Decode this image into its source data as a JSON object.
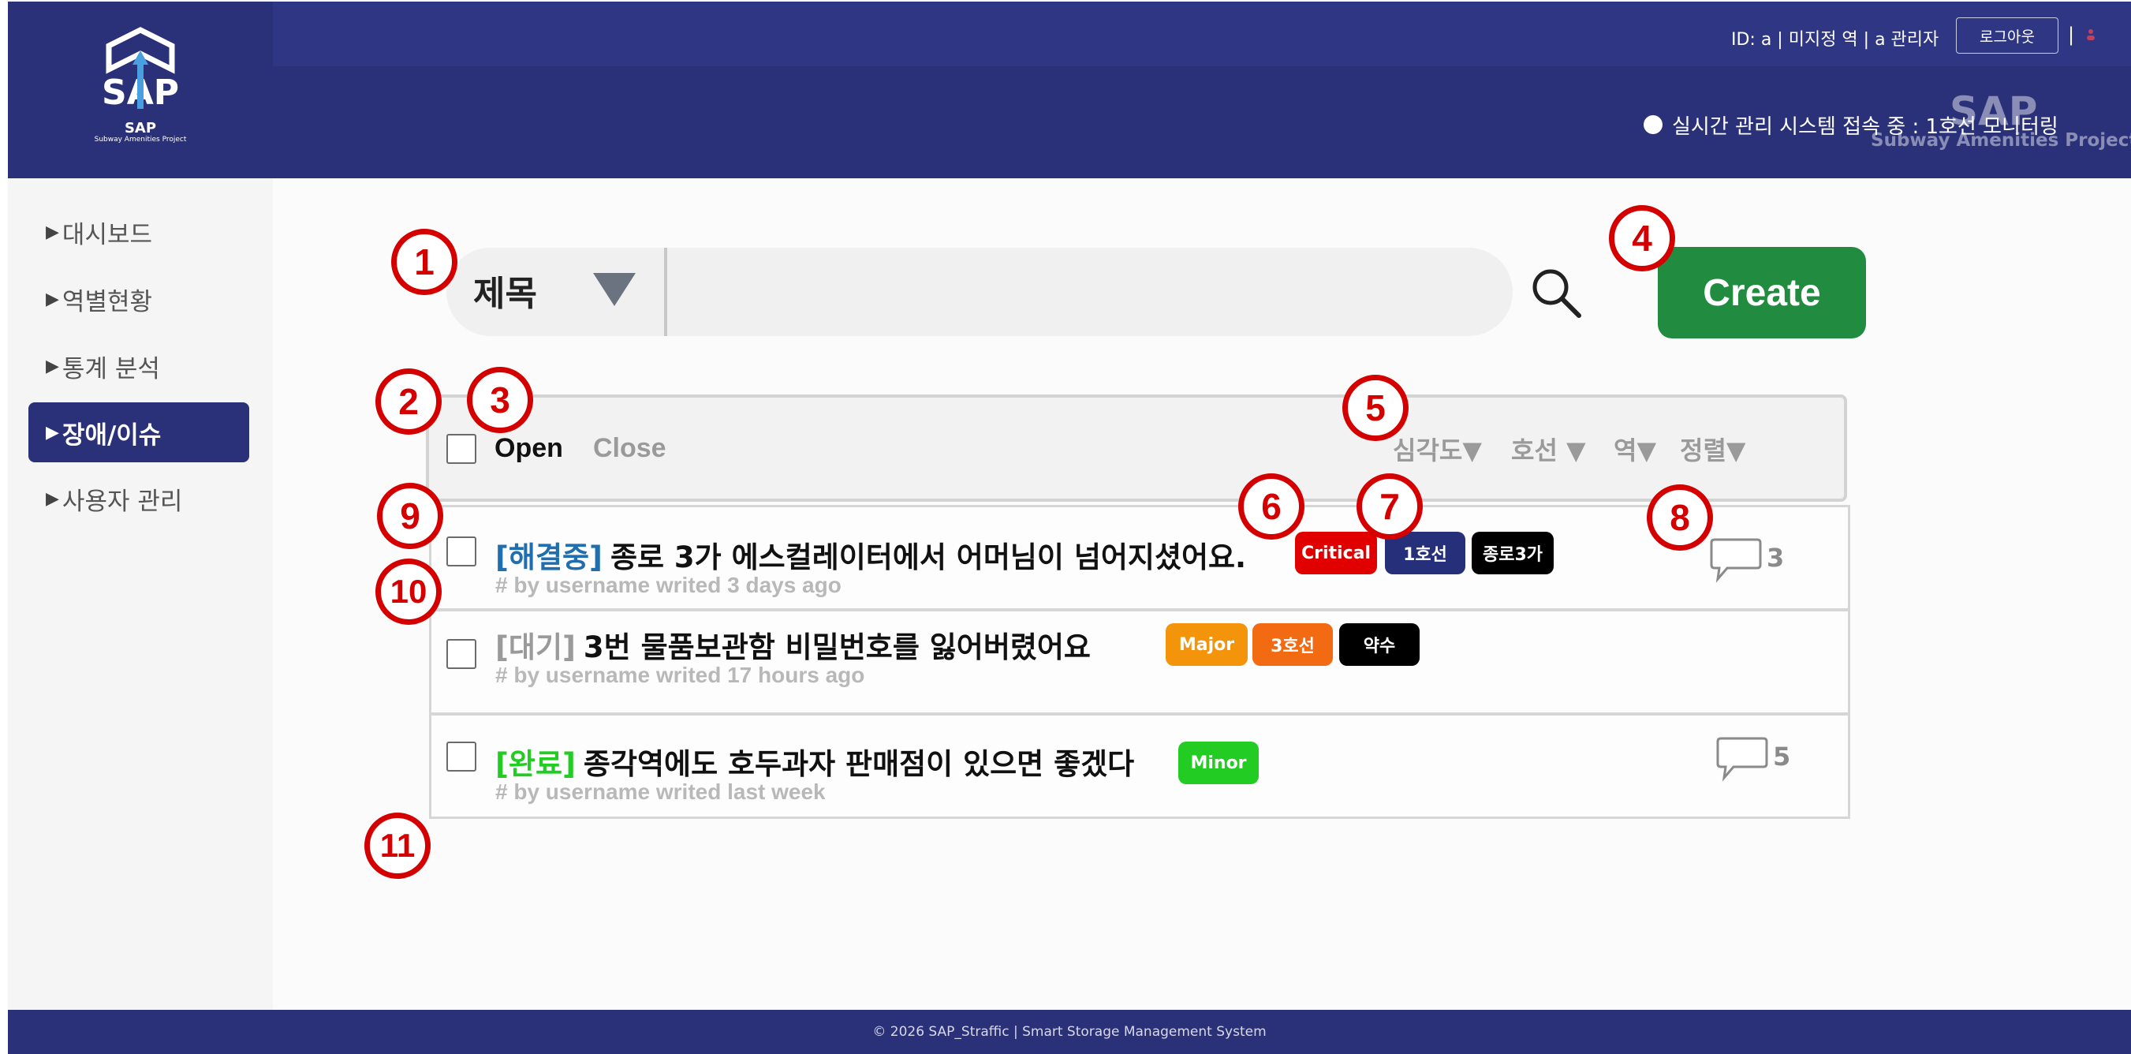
{
  "header": {
    "logo_text": "SAP",
    "logo_subtext": "Subway Amenities Project",
    "user_info": "ID: a | 미지정 역 | a 관리자",
    "logout_label": "로그아웃",
    "separator": "|",
    "status_text": "실시간 관리 시스템 접속 중 : 1호선 모니터링",
    "watermark_title": "SAP",
    "watermark_subtitle": "Subway Amenities Project"
  },
  "sidebar": {
    "items": [
      {
        "label": "대시보드",
        "active": false
      },
      {
        "label": "역별현황",
        "active": false
      },
      {
        "label": "통계 분석",
        "active": false
      },
      {
        "label": "장애/이슈",
        "active": true
      },
      {
        "label": "사용자 관리",
        "active": false
      }
    ]
  },
  "search": {
    "type_label": "제목",
    "placeholder": "",
    "create_label": "Create"
  },
  "filters": {
    "open_label": "Open",
    "close_label": "Close",
    "severity_label": "심각도▼",
    "line_label": "호선 ▼",
    "station_label": "역▼",
    "sort_label": "정렬▼"
  },
  "issues": [
    {
      "status": "[해결중]",
      "status_color": "#1f6fb0",
      "title": "종로 3가 에스컬레이터에서 어머님이 넘어지셨어요.",
      "meta": "# by username writed 3 days ago",
      "tags": [
        {
          "label": "Critical",
          "color": "#e00000"
        },
        {
          "label": "1호선",
          "color": "#262f7a"
        },
        {
          "label": "종로3가",
          "color": "#000000"
        }
      ],
      "comments": "3"
    },
    {
      "status": "[대기]",
      "status_color": "#9a9a9a",
      "title": "3번 물품보관함 비밀번호를 잃어버렸어요",
      "meta": "# by username writed 17 hours ago",
      "tags": [
        {
          "label": "Major",
          "color": "#f4940b"
        },
        {
          "label": "3호선",
          "color": "#f26a12"
        },
        {
          "label": "약수",
          "color": "#000000"
        }
      ],
      "comments": ""
    },
    {
      "status": "[완료]",
      "status_color": "#22cc22",
      "title": "종각역에도 호두과자 판매점이 있으면 좋겠다",
      "meta": "# by username writed last week",
      "tags": [
        {
          "label": "Minor",
          "color": "#22cc22"
        }
      ],
      "comments": "5"
    }
  ],
  "annotations": [
    "1",
    "2",
    "3",
    "4",
    "5",
    "6",
    "7",
    "8",
    "9",
    "10",
    "11"
  ],
  "footer": {
    "text": "© 2026 SAP_Straffic | Smart Storage Management System"
  },
  "colors": {
    "header": "#2a3178",
    "create_button": "#218c3f",
    "annotation": "#d40000"
  }
}
